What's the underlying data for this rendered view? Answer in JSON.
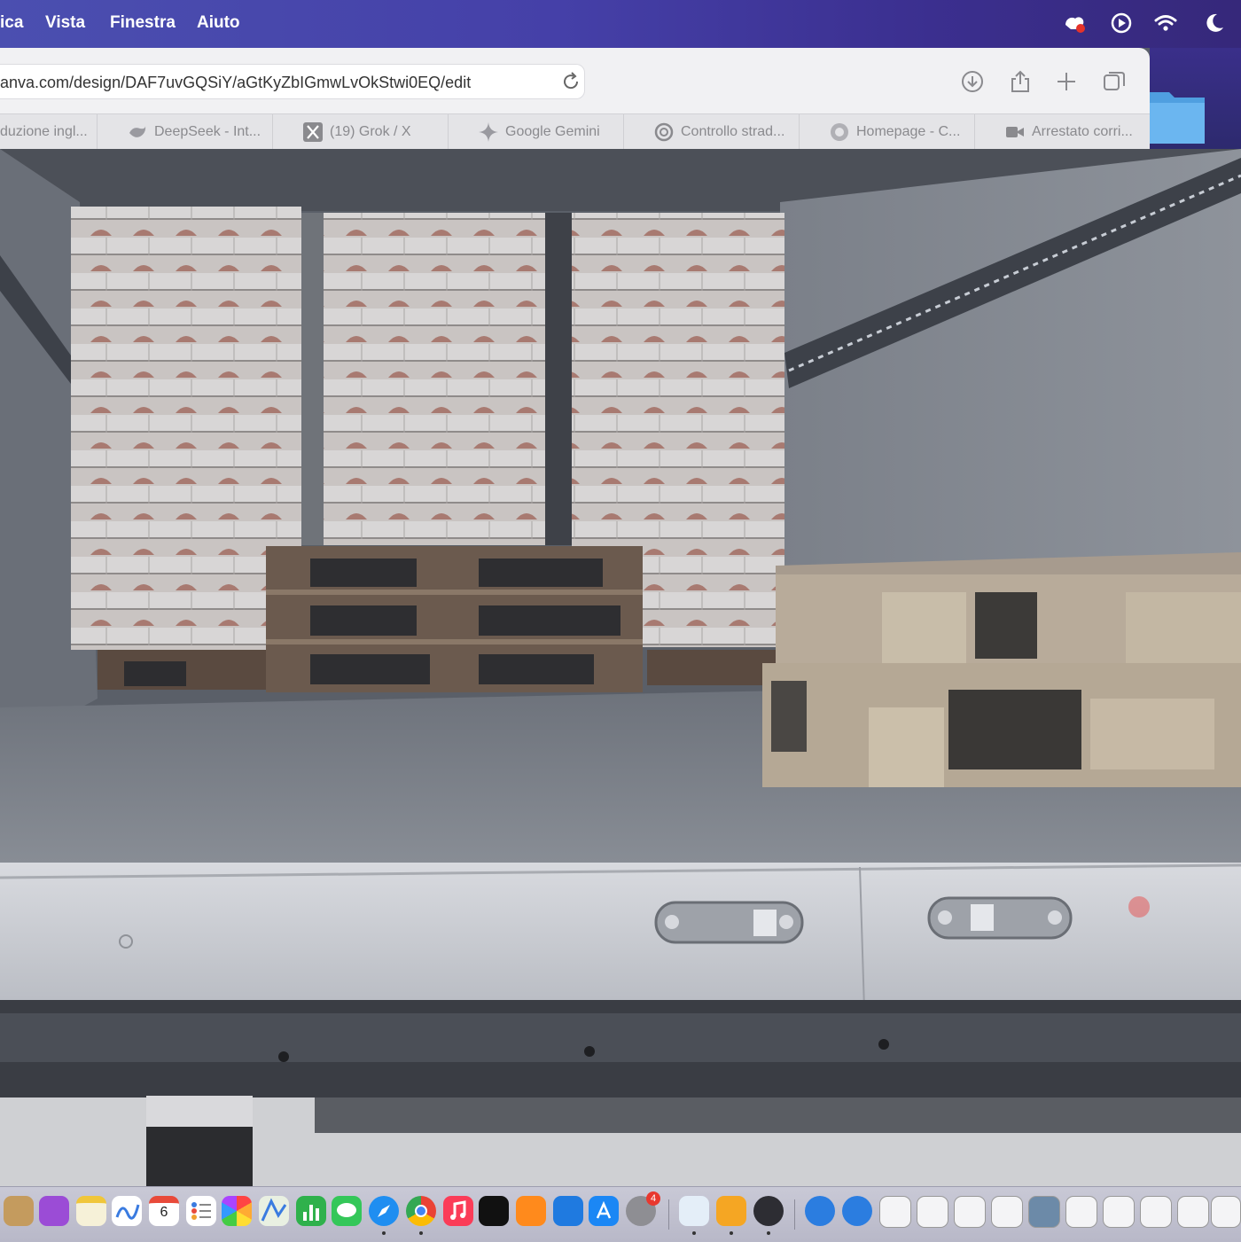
{
  "menubar": {
    "items": [
      "ica",
      "Vista",
      "Finestra",
      "Aiuto"
    ],
    "status_icons": [
      "creative-cloud-icon",
      "play-circle-icon",
      "wifi-icon",
      "moon-icon"
    ]
  },
  "browser": {
    "url": "anva.com/design/DAF7uvGQSiY/aGtKyZbIGmwLvOkStwi0EQ/edit",
    "toolbar_icons": [
      "download-icon",
      "share-icon",
      "new-tab-icon",
      "tab-overview-icon"
    ],
    "tabs": [
      {
        "label": "duzione ingl...",
        "icon": ""
      },
      {
        "label": "DeepSeek - Int...",
        "icon": "deepseek-icon"
      },
      {
        "label": "(19) Grok / X",
        "icon": "x-icon"
      },
      {
        "label": "Google Gemini",
        "icon": "gemini-icon"
      },
      {
        "label": "Controllo strad...",
        "icon": "openai-icon"
      },
      {
        "label": "Homepage - C...",
        "icon": "homepage-icon"
      },
      {
        "label": "Arrestato corri...",
        "icon": "video-icon"
      }
    ]
  },
  "dock": {
    "calendar_date": "6",
    "system_preferences_badge": "4"
  },
  "colors": {
    "menubar_accent": "#4540a8",
    "folder": "#5aa9e6"
  }
}
